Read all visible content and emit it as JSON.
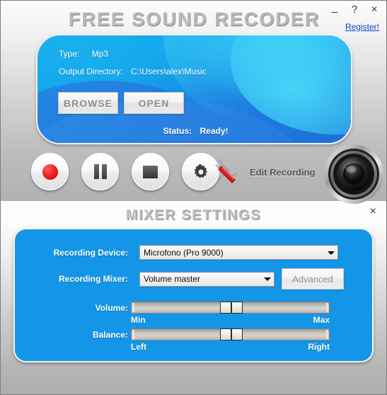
{
  "window": {
    "title": "FREE SOUND RECODER",
    "minimize_label": "_",
    "help_label": "?",
    "close_label": "×",
    "register_label": "Register!"
  },
  "output_panel": {
    "type_label": "Type:",
    "type_value": "Mp3",
    "directory_label": "Output Directory:",
    "directory_value": "C:\\Users\\alex\\Music",
    "browse_label": "BROWSE",
    "open_label": "OPEN",
    "status_label": "Status:",
    "status_value": "Ready!"
  },
  "controls": {
    "record": "record-button",
    "pause": "pause-button",
    "stop": "stop-button",
    "settings": "settings-button",
    "edit_recording_label": "Edit Recording"
  },
  "mixer": {
    "title": "MIXER SETTINGS",
    "close_label": "×",
    "device_label": "Recording Device:",
    "device_value": "Microfono (Pro 9000)",
    "mixer_label": "Recording Mixer:",
    "mixer_value": "Volume master",
    "advanced_label": "Advanced",
    "volume_label": "Volume:",
    "volume_min_label": "Min",
    "volume_max_label": "Max",
    "volume_percent": 50,
    "balance_label": "Balance:",
    "balance_left_label": "Left",
    "balance_right_label": "Right",
    "balance_percent": 50
  },
  "colors": {
    "panel_blue": "#1496e8",
    "panel_blue_dark": "#1f6fd8",
    "accent_cyan": "#16a8ec",
    "record_red": "#e81a1a",
    "link_blue": "#1b3fc4",
    "window_gray": "#b0b0b0"
  }
}
